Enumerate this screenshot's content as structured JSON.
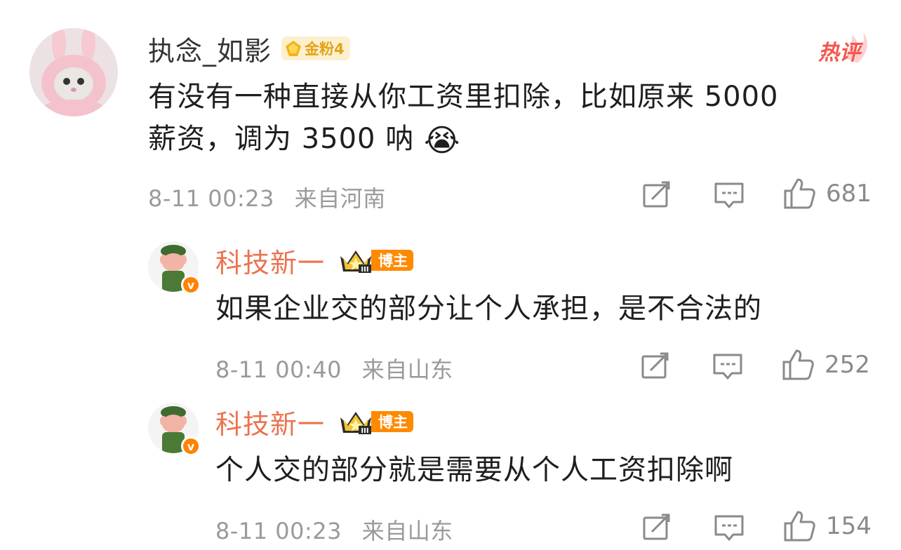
{
  "comments": [
    {
      "username": "执念_如影",
      "badge": "金粉4",
      "hot_label": "热评",
      "text_line1": "有没有一种直接从你工资里扣除，比如原来 5000",
      "text_line2": "薪资，调为 3500 呐",
      "emoji": "😭",
      "time": "8-11 00:23",
      "location": "来自河南",
      "likes": "681"
    },
    {
      "username": "科技新一",
      "badge": "博主",
      "verified": "v",
      "text": "如果企业交的部分让个人承担，是不合法的",
      "time": "8-11 00:40",
      "location": "来自山东",
      "likes": "252"
    },
    {
      "username": "科技新一",
      "badge": "博主",
      "verified": "v",
      "text": "个人交的部分就是需要从个人工资扣除啊",
      "time": "8-11 00:23",
      "location": "来自山东",
      "likes": "154"
    }
  ],
  "colors": {
    "reply_name": "#eb7350",
    "meta": "#9a9a9a",
    "hot": "#f5564f",
    "badge_orange": "#ff8a00"
  },
  "icons": [
    "repost-icon",
    "comment-icon",
    "like-icon",
    "crown-icon",
    "gem-icon",
    "hot-icon",
    "verified-icon"
  ]
}
